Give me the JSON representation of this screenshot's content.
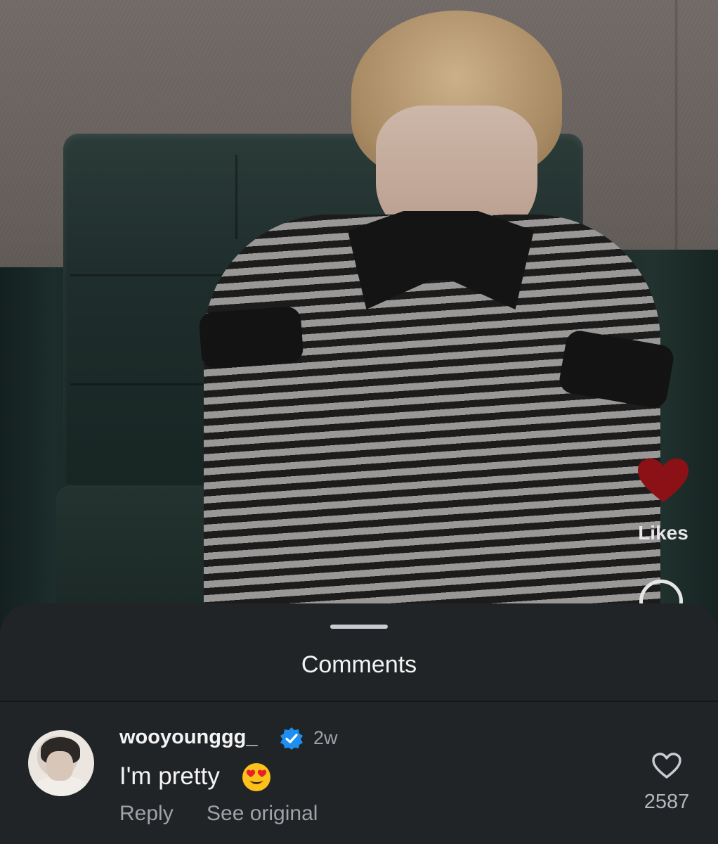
{
  "actions": {
    "likes_label": "Likes",
    "heart_color": "#8b1116"
  },
  "comments_sheet": {
    "title": "Comments",
    "comments": [
      {
        "username": "wooyounggg_",
        "verified": true,
        "time": "2w",
        "text": "I'm pretty",
        "emoji": "heart-eyes-emoji",
        "reply_label": "Reply",
        "see_original_label": "See original",
        "like_count": "2587"
      }
    ]
  },
  "colors": {
    "sheet_background": "#212427",
    "verified_badge": "#1d8ff0",
    "secondary_text": "#9ea3a8"
  }
}
